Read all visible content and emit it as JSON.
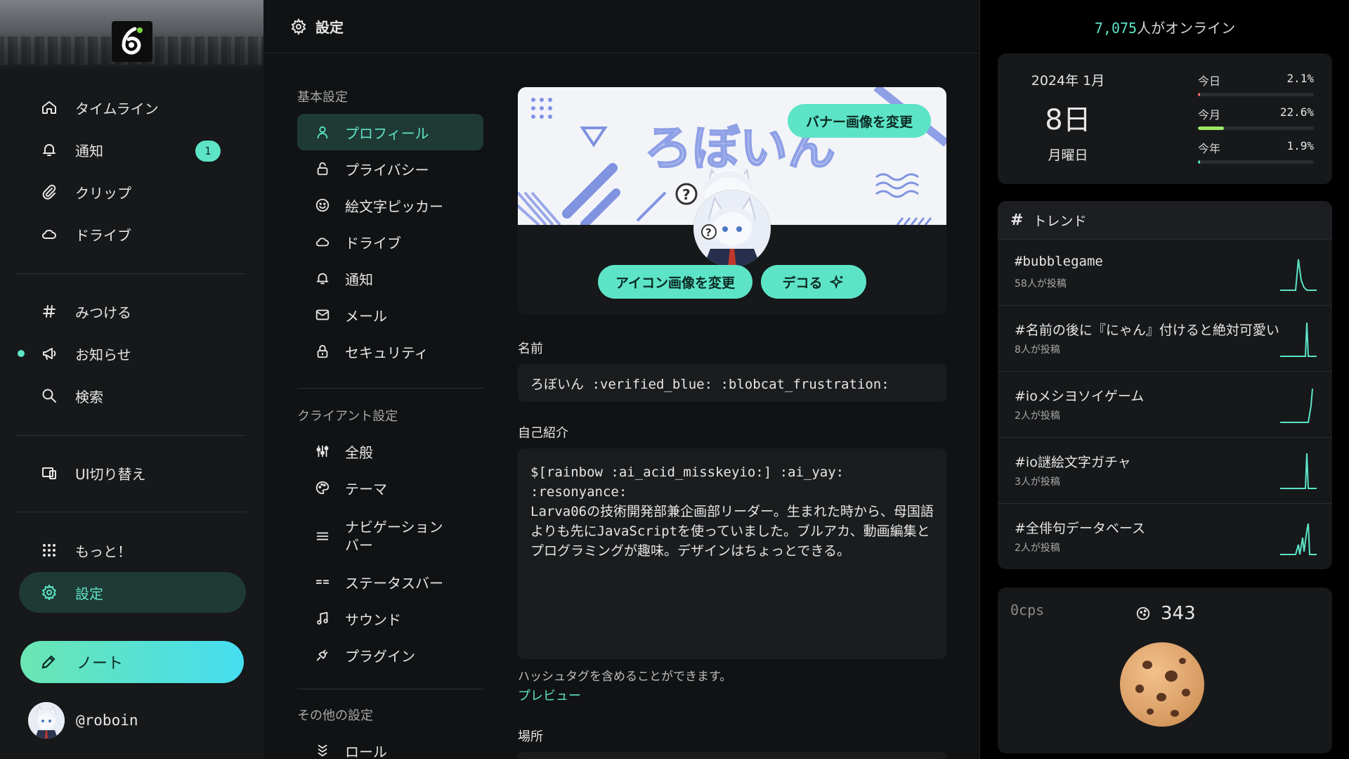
{
  "nav": {
    "items": [
      {
        "label": "タイムライン",
        "icon": "home-icon"
      },
      {
        "label": "通知",
        "icon": "bell-icon",
        "badge": "1"
      },
      {
        "label": "クリップ",
        "icon": "paperclip-icon"
      },
      {
        "label": "ドライブ",
        "icon": "cloud-icon"
      },
      {
        "label": "みつける",
        "icon": "hash-icon"
      },
      {
        "label": "お知らせ",
        "icon": "megaphone-icon"
      },
      {
        "label": "検索",
        "icon": "search-icon"
      },
      {
        "label": "UI切り替え",
        "icon": "devices-icon"
      },
      {
        "label": "もっと！",
        "icon": "grid-dots-icon"
      },
      {
        "label": "設定",
        "icon": "gear-icon",
        "active": true
      }
    ],
    "note_button": "ノート",
    "account_handle": "@roboin"
  },
  "main": {
    "header_title": "設定",
    "menu": {
      "sections": [
        "基本設定",
        "クライアント設定",
        "その他の設定"
      ],
      "basic": [
        "プロフィール",
        "プライバシー",
        "絵文字ピッカー",
        "ドライブ",
        "通知",
        "メール",
        "セキュリティ"
      ],
      "client": [
        "全般",
        "テーマ",
        "ナビゲーション\nバー",
        "ステータスバー",
        "サウンド",
        "プラグイン"
      ],
      "other": [
        "ロール"
      ]
    },
    "profile": {
      "banner_text": "ろぼいん",
      "change_banner": "バナー画像を変更",
      "change_icon": "アイコン画像を変更",
      "deco": "デコる",
      "name_label": "名前",
      "name_value": "ろぼいん :verified_blue: :blobcat_frustration:",
      "bio_label": "自己紹介",
      "bio_value": "$[rainbow :ai_acid_misskeyio:] :ai_yay: :resonyance:\nLarva06の技術開発部兼企画部リーダー。生まれた時から、母国語よりも先にJavaScriptを使っていました。ブルアカ、動画編集とプログラミングが趣味。デザインはちょっとできる。",
      "bio_hint": "ハッシュタグを含めることができます。",
      "preview": "プレビュー",
      "location_label": "場所"
    }
  },
  "widgets": {
    "online_count": "7,075",
    "online_suffix": "人がオンライン",
    "calendar": {
      "year_month": "2024年 1月",
      "day": "8日",
      "weekday": "月曜日",
      "stats": [
        {
          "label": "今日",
          "value": "2.1%",
          "fraction": 0.021,
          "color": "#ff6b6b"
        },
        {
          "label": "今月",
          "value": "22.6%",
          "fraction": 0.226,
          "color": "#9be564"
        },
        {
          "label": "今年",
          "value": "1.9%",
          "fraction": 0.019,
          "color": "#5de4c7"
        }
      ]
    },
    "trends": {
      "title": "トレンド",
      "items": [
        {
          "tag": "#bubblegame",
          "count": "58人が投稿"
        },
        {
          "tag": "#名前の後に『にゃん』付けると絶対可愛い",
          "count": "8人が投稿"
        },
        {
          "tag": "#ioメシヨソイゲーム",
          "count": "2人が投稿"
        },
        {
          "tag": "#io謎絵文字ガチャ",
          "count": "3人が投稿"
        },
        {
          "tag": "#全俳句データベース",
          "count": "2人が投稿"
        }
      ]
    },
    "clicker": {
      "cps": "0cps",
      "cookies": "343"
    }
  }
}
